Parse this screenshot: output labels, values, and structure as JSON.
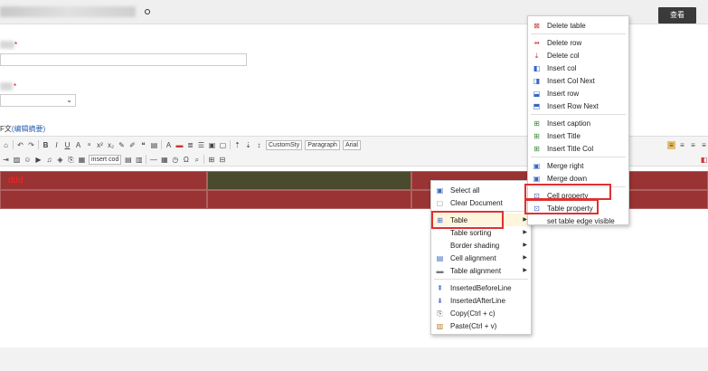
{
  "header": {
    "view_button": "查看"
  },
  "form": {
    "field1_required": "*",
    "field2_required": "*",
    "section_label": "F文",
    "section_link": "(编辑摘要)"
  },
  "toolbar": {
    "dropdowns": [
      "CustomSty",
      "Paragraph",
      "Arial"
    ],
    "insert_code": "insert cod"
  },
  "table_cells": {
    "r1c1": "ddd"
  },
  "context_menu": {
    "items": [
      {
        "label": "Select all",
        "icon": "select-all-icon",
        "submenu": false
      },
      {
        "label": "Clear Document",
        "icon": "clear-document-icon",
        "submenu": false
      },
      {
        "label": "Table",
        "icon": "table-icon",
        "submenu": true,
        "highlighted": true
      },
      {
        "label": "Table sorting",
        "icon": "",
        "submenu": true
      },
      {
        "label": "Border shading",
        "icon": "",
        "submenu": true
      },
      {
        "label": "Cell alignment",
        "icon": "cell-alignment-icon",
        "submenu": true
      },
      {
        "label": "Table alignment",
        "icon": "table-alignment-icon",
        "submenu": true
      },
      {
        "label": "InsertedBeforeLine",
        "icon": "insert-before-line-icon",
        "submenu": false
      },
      {
        "label": "InsertedAfterLine",
        "icon": "insert-after-line-icon",
        "submenu": false
      },
      {
        "label": "Copy(Ctrl + c)",
        "icon": "copy-icon",
        "submenu": false
      },
      {
        "label": "Paste(Ctrl + v)",
        "icon": "paste-icon",
        "submenu": false
      }
    ]
  },
  "table_submenu": {
    "items": [
      {
        "label": "Delete table",
        "icon": "delete-table-icon"
      },
      {
        "label": "Delete row",
        "icon": "delete-row-icon"
      },
      {
        "label": "Delete col",
        "icon": "delete-col-icon"
      },
      {
        "label": "Insert col",
        "icon": "insert-col-icon"
      },
      {
        "label": "Insert Col Next",
        "icon": "insert-col-next-icon"
      },
      {
        "label": "Insert row",
        "icon": "insert-row-icon"
      },
      {
        "label": "Insert Row Next",
        "icon": "insert-row-next-icon"
      },
      {
        "label": "Insert caption",
        "icon": "insert-caption-icon"
      },
      {
        "label": "Insert Title",
        "icon": "insert-title-icon"
      },
      {
        "label": "Insert Title Col",
        "icon": "insert-title-col-icon"
      },
      {
        "label": "Merge right",
        "icon": "merge-right-icon"
      },
      {
        "label": "Merge down",
        "icon": "merge-down-icon"
      },
      {
        "label": "Cell property",
        "icon": "cell-property-icon"
      },
      {
        "label": "Table property",
        "icon": "table-property-icon"
      },
      {
        "label": "set table edge visible",
        "icon": ""
      }
    ]
  },
  "colors": {
    "cell_red": "#9a3333",
    "cell_dark": "#4a4a2e",
    "highlight_red": "#e03030",
    "cell_text": "#ff2020"
  }
}
